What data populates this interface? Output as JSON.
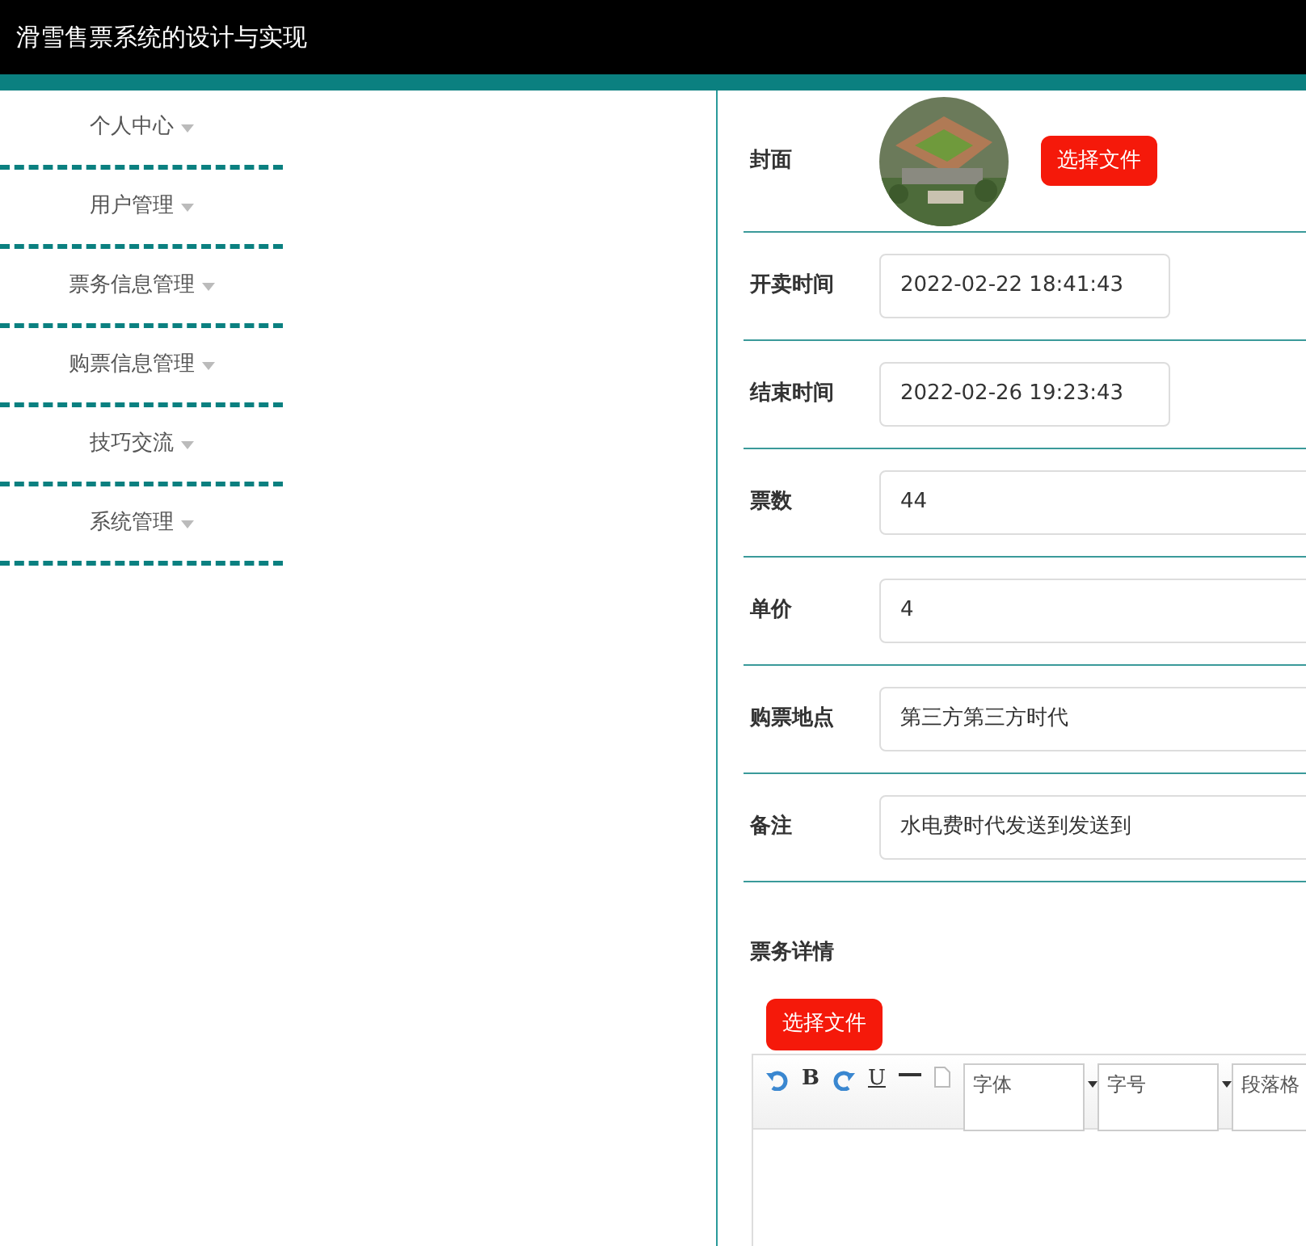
{
  "header": {
    "title": "滑雪售票系统的设计与实现"
  },
  "sidebar": {
    "items": [
      {
        "label": "个人中心"
      },
      {
        "label": "用户管理"
      },
      {
        "label": "票务信息管理"
      },
      {
        "label": "购票信息管理"
      },
      {
        "label": "技巧交流"
      },
      {
        "label": "系统管理"
      }
    ]
  },
  "form": {
    "cover": {
      "label": "封面",
      "button": "选择文件"
    },
    "fields": [
      {
        "label": "开卖时间",
        "value": "2022-02-22 18:41:43",
        "kind": "date"
      },
      {
        "label": "结束时间",
        "value": "2022-02-26 19:23:43",
        "kind": "date"
      },
      {
        "label": "票数",
        "value": "44",
        "kind": "text"
      },
      {
        "label": "单价",
        "value": "4",
        "kind": "text"
      },
      {
        "label": "购票地点",
        "value": "第三方第三方时代",
        "kind": "text"
      },
      {
        "label": "备注",
        "value": "水电费时代发送到发送到",
        "kind": "text"
      }
    ],
    "details": {
      "label": "票务详情",
      "button": "选择文件",
      "toolbar": {
        "bold": "B",
        "underline": "U",
        "selects": [
          {
            "label": "字体"
          },
          {
            "label": "字号"
          },
          {
            "label": "段落格"
          }
        ]
      }
    }
  }
}
